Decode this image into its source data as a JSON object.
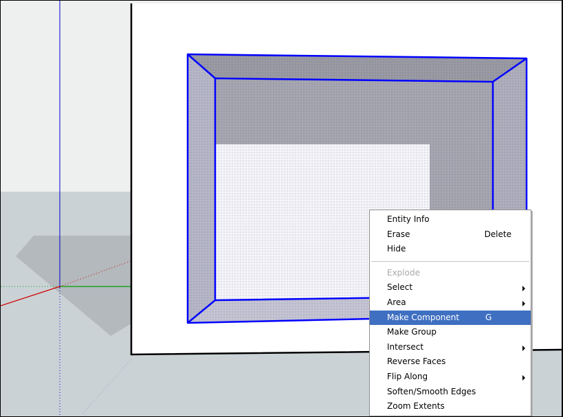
{
  "context_menu": {
    "groups": [
      [
        {
          "label": "Entity Info",
          "shortcut": "",
          "submenu": false,
          "disabled": false,
          "highlighted": false
        },
        {
          "label": "Erase",
          "shortcut": "Delete",
          "submenu": false,
          "disabled": false,
          "highlighted": false
        },
        {
          "label": "Hide",
          "shortcut": "",
          "submenu": false,
          "disabled": false,
          "highlighted": false
        }
      ],
      [
        {
          "label": "Explode",
          "shortcut": "",
          "submenu": false,
          "disabled": true,
          "highlighted": false
        },
        {
          "label": "Select",
          "shortcut": "",
          "submenu": true,
          "disabled": false,
          "highlighted": false
        },
        {
          "label": "Area",
          "shortcut": "",
          "submenu": true,
          "disabled": false,
          "highlighted": false
        },
        {
          "label": "Make Component",
          "shortcut": "G",
          "submenu": false,
          "disabled": false,
          "highlighted": true
        },
        {
          "label": "Make Group",
          "shortcut": "",
          "submenu": false,
          "disabled": false,
          "highlighted": false
        },
        {
          "label": "Intersect",
          "shortcut": "",
          "submenu": true,
          "disabled": false,
          "highlighted": false
        },
        {
          "label": "Reverse Faces",
          "shortcut": "",
          "submenu": false,
          "disabled": false,
          "highlighted": false
        },
        {
          "label": "Flip Along",
          "shortcut": "",
          "submenu": true,
          "disabled": false,
          "highlighted": false
        },
        {
          "label": "Soften/Smooth Edges",
          "shortcut": "",
          "submenu": false,
          "disabled": false,
          "highlighted": false
        },
        {
          "label": "Zoom Extents",
          "shortcut": "",
          "submenu": false,
          "disabled": false,
          "highlighted": false
        }
      ]
    ]
  },
  "colors": {
    "sky": "#eef0f0",
    "ground": "#cbd2d6",
    "shadow": "#b3b9bd",
    "selection_edge": "#0000ff",
    "face_top": "#9a9aa3",
    "face_side": "#b6b6c6",
    "face_inner": "#f4f4f8",
    "menu_highlight": "#3f6fc1",
    "axis_red": "#d00000",
    "axis_green": "#00a000",
    "axis_blue": "#0000c8"
  }
}
